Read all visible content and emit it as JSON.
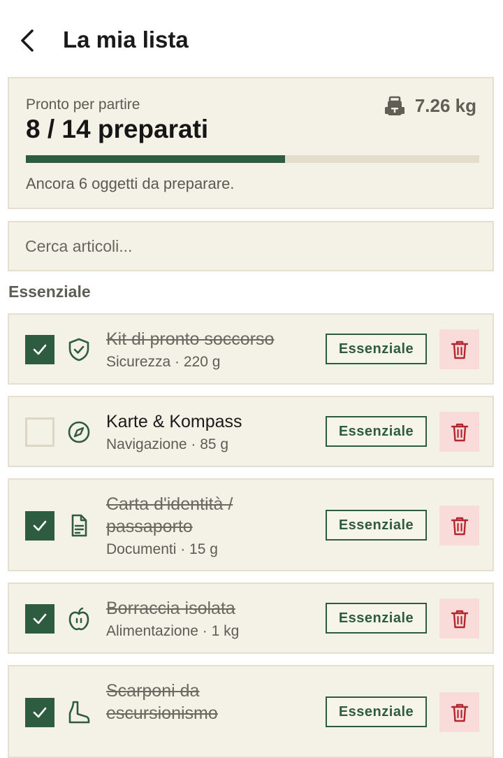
{
  "header": {
    "title": "La mia lista",
    "back_icon": "chevron-left-icon"
  },
  "summary": {
    "subtitle": "Pronto per partire",
    "count_text": "8 / 14 preparati",
    "packed": 8,
    "total": 14,
    "progress_fraction": 0.5714,
    "weight": "7.26 kg",
    "weight_icon": "backpack-icon",
    "remaining_text": "Ancora 6 oggetti da preparare."
  },
  "search": {
    "placeholder": "Cerca articoli..."
  },
  "section": {
    "title": "Essenziale"
  },
  "items": [
    {
      "name": "Kit di pronto soccorso",
      "meta": "Sicurezza · 220 g",
      "checked": true,
      "icon": "shield-check-icon",
      "badge": "Essenziale"
    },
    {
      "name": "Karte & Kompass",
      "meta": "Navigazione · 85 g",
      "checked": false,
      "icon": "compass-icon",
      "badge": "Essenziale"
    },
    {
      "name": "Carta d'identità / passaporto",
      "meta": "Documenti · 15 g",
      "checked": true,
      "icon": "document-icon",
      "badge": "Essenziale"
    },
    {
      "name": "Borraccia isolata",
      "meta": "Alimentazione · 1 kg",
      "checked": true,
      "icon": "apple-icon",
      "badge": "Essenziale"
    },
    {
      "name": "Scarponi da escursionismo",
      "meta": "",
      "checked": true,
      "icon": "boot-icon",
      "badge": "Essenziale"
    }
  ],
  "colors": {
    "accent": "#2e5c40",
    "card_bg": "#f4f1e7",
    "card_border": "#e6dfcd",
    "delete_bg": "#f9dcda",
    "delete_icon": "#b3262e"
  }
}
